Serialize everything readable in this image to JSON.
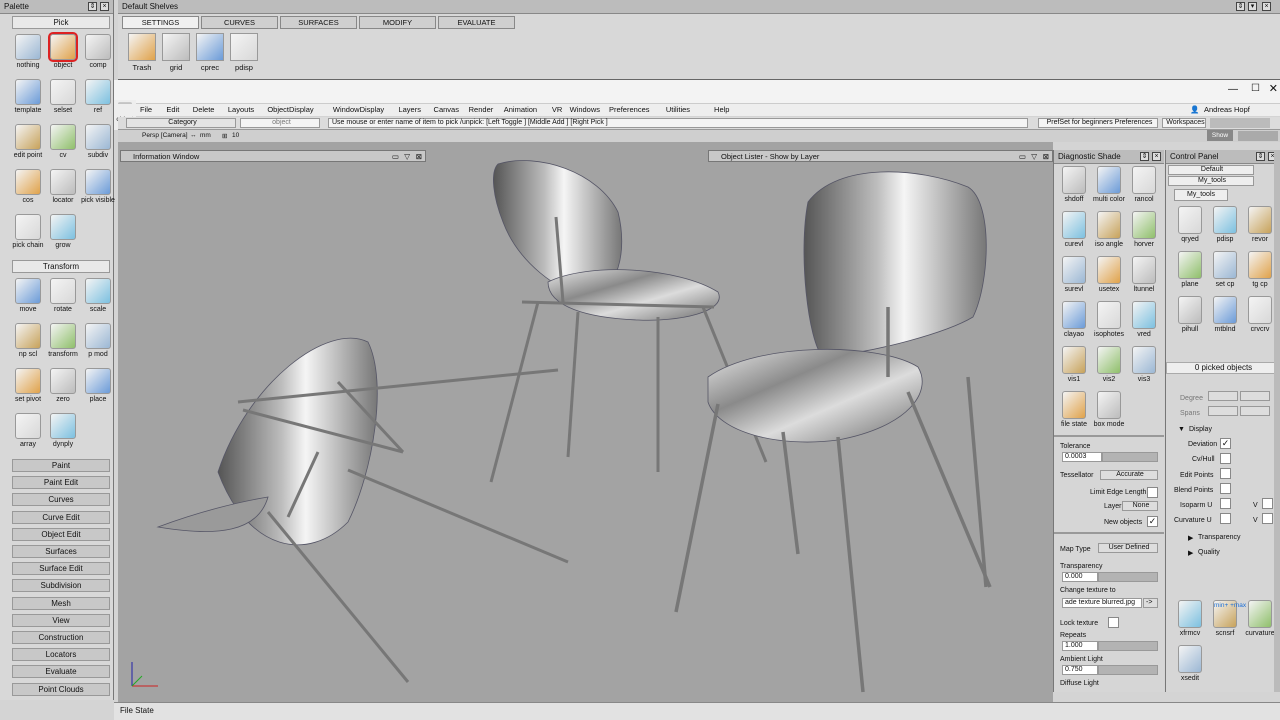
{
  "palette": {
    "title": "Palette",
    "pick_header": "Pick",
    "pick_tools": [
      {
        "label": "nothing",
        "icon": "pick-nothing-icon"
      },
      {
        "label": "object",
        "icon": "pick-object-icon"
      },
      {
        "label": "comp",
        "icon": "pick-component-icon"
      },
      {
        "label": "template",
        "icon": "pick-template-icon"
      },
      {
        "label": "selset",
        "icon": "pick-selset-icon"
      },
      {
        "label": "ref",
        "icon": "pick-ref-icon"
      },
      {
        "label": "edit point",
        "icon": "pick-edit-point-icon"
      },
      {
        "label": "cv",
        "icon": "pick-cv-icon"
      },
      {
        "label": "subdiv",
        "icon": "pick-subdiv-icon"
      },
      {
        "label": "cos",
        "icon": "pick-cos-icon"
      },
      {
        "label": "locator",
        "icon": "pick-locator-icon"
      },
      {
        "label": "pick visible",
        "icon": "pick-visible-icon"
      },
      {
        "label": "pick chain",
        "icon": "pick-chain-icon"
      },
      {
        "label": "grow",
        "icon": "pick-grow-icon"
      }
    ],
    "transform_header": "Transform",
    "transform_tools": [
      {
        "label": "move",
        "icon": "move-icon"
      },
      {
        "label": "rotate",
        "icon": "rotate-icon"
      },
      {
        "label": "scale",
        "icon": "scale-icon"
      },
      {
        "label": "np scl",
        "icon": "nonprop-scale-icon"
      },
      {
        "label": "transform",
        "icon": "transform-icon"
      },
      {
        "label": "p mod",
        "icon": "pivot-mod-icon"
      },
      {
        "label": "set pivot",
        "icon": "set-pivot-icon"
      },
      {
        "label": "zero",
        "icon": "zero-icon"
      },
      {
        "label": "place",
        "icon": "place-icon"
      },
      {
        "label": "array",
        "icon": "array-icon"
      },
      {
        "label": "dynply",
        "icon": "dynply-icon"
      }
    ],
    "sections": [
      "Paint",
      "Paint Edit",
      "Curves",
      "Curve Edit",
      "Object Edit",
      "Surfaces",
      "Surface Edit",
      "Subdivision",
      "Mesh",
      "View",
      "Construction",
      "Locators",
      "Evaluate",
      "Point Clouds"
    ]
  },
  "shelves": {
    "title": "Default Shelves",
    "tabs": [
      "SETTINGS",
      "CURVES",
      "SURFACES",
      "MODIFY",
      "EVALUATE"
    ],
    "tools": [
      {
        "label": "Trash",
        "icon": "trash-icon"
      },
      {
        "label": "grid",
        "icon": "grid-snap-icon"
      },
      {
        "label": "cprec",
        "icon": "cprec-icon"
      },
      {
        "label": "pdisp",
        "icon": "pdisp-icon"
      }
    ]
  },
  "menubar": {
    "object_label": "object",
    "items": [
      "File",
      "Edit",
      "Delete",
      "Layouts",
      "ObjectDisplay",
      "WindowDisplay",
      "Layers",
      "Canvas",
      "Render",
      "Animation",
      "VR",
      "Windows",
      "Preferences",
      "Utilities",
      "Help"
    ],
    "user": "Andreas Hopf"
  },
  "cmdbar": {
    "category": "Category",
    "object": "object",
    "prompt": "Use mouse or enter name of item to pick /unpick: [Left Toggle ] [Middle Add ] [Right Pick ]",
    "prefset": "PrefSet for beginners Preferences",
    "workspaces": "Workspaces",
    "show": "Show"
  },
  "viewhdr": {
    "camera": "Persp [Camera]",
    "units": "mm",
    "grid_value": "10"
  },
  "viewport": {
    "info_window": "Information Window",
    "object_lister": "Object Lister - Show by Layer"
  },
  "diag": {
    "title": "Diagnostic Shade",
    "tools": [
      {
        "label": "shdoff",
        "icon": "shade-off-icon"
      },
      {
        "label": "multi color",
        "icon": "multi-color-icon"
      },
      {
        "label": "rancol",
        "icon": "random-color-icon"
      },
      {
        "label": "curevl",
        "icon": "curvature-eval-icon"
      },
      {
        "label": "iso angle",
        "icon": "iso-angle-icon"
      },
      {
        "label": "horver",
        "icon": "horizontal-vertical-icon"
      },
      {
        "label": "surevl",
        "icon": "surface-eval-icon"
      },
      {
        "label": "usetex",
        "icon": "use-texture-icon"
      },
      {
        "label": "ltunnel",
        "icon": "light-tunnel-icon"
      },
      {
        "label": "clayao",
        "icon": "clay-ao-icon"
      },
      {
        "label": "isophotes",
        "icon": "isophotes-icon"
      },
      {
        "label": "vred",
        "icon": "vred-icon"
      },
      {
        "label": "vis1",
        "icon": "vis1-icon"
      },
      {
        "label": "vis2",
        "icon": "vis2-icon"
      },
      {
        "label": "vis3",
        "icon": "vis3-icon"
      },
      {
        "label": "file state",
        "icon": "file-state-icon"
      },
      {
        "label": "box mode",
        "icon": "box-mode-icon"
      }
    ],
    "tolerance_label": "Tolerance",
    "tolerance_value": "0.0003",
    "tessellator_label": "Tessellator",
    "tessellator_value": "Accurate",
    "limit_edge": "Limit Edge Length",
    "layer_label": "Layer",
    "layer_value": "None",
    "new_objects": "New objects",
    "map_type_label": "Map Type",
    "map_type_value": "User Defined",
    "transparency_label": "Transparency",
    "transparency_value": "0.000",
    "change_texture": "Change texture to",
    "texture_file": "ade texture blurred.jpg",
    "texture_btn": "->",
    "lock_texture": "Lock texture",
    "repeats_label": "Repeats",
    "repeats_value": "1.000",
    "ambient_label": "Ambient Light",
    "ambient_value": "0.750",
    "diffuse_label": "Diffuse Light"
  },
  "ctrl": {
    "title": "Control Panel",
    "preset": "Default",
    "shelf": "My_tools",
    "shelf_tab": "My_tools",
    "tools": [
      {
        "label": "qryed",
        "icon": "query-edit-icon"
      },
      {
        "label": "pdisp",
        "icon": "pdisp-icon"
      },
      {
        "label": "revor",
        "icon": "revolve-icon"
      },
      {
        "label": "plane",
        "icon": "plane-icon"
      },
      {
        "label": "set cp",
        "icon": "set-cp-icon"
      },
      {
        "label": "tg cp",
        "icon": "tangent-cp-icon"
      },
      {
        "label": "pihull",
        "icon": "pihull-icon"
      },
      {
        "label": "mtblnd",
        "icon": "multi-blend-icon"
      },
      {
        "label": "crvcrv",
        "icon": "curve-curve-icon"
      }
    ],
    "picked": "0 picked objects",
    "degree": "Degree",
    "spans": "Spans",
    "display_header": "Display",
    "deviation": "Deviation",
    "cvhull": "Cv/Hull",
    "edit_points": "Edit Points",
    "blend_points": "Blend Points",
    "isoparm_u": "Isoparm U",
    "curvature_u": "Curvature U",
    "v": "V",
    "transparency": "Transparency",
    "quality": "Quality",
    "bottom_tools": [
      {
        "label": "xfrmcv",
        "icon": "xfrmcv-icon"
      },
      {
        "label": "scnsrf",
        "icon": "scnsrf-icon"
      },
      {
        "label": "curvature",
        "icon": "curvature-icon"
      },
      {
        "label": "xsedit",
        "icon": "xsedit-icon"
      }
    ],
    "minmax": "min+ +max"
  },
  "status": "File State",
  "colors": {
    "accent_red": "#dd2222",
    "panel": "#d6d6d6",
    "viewport": "#a3a3a3"
  }
}
